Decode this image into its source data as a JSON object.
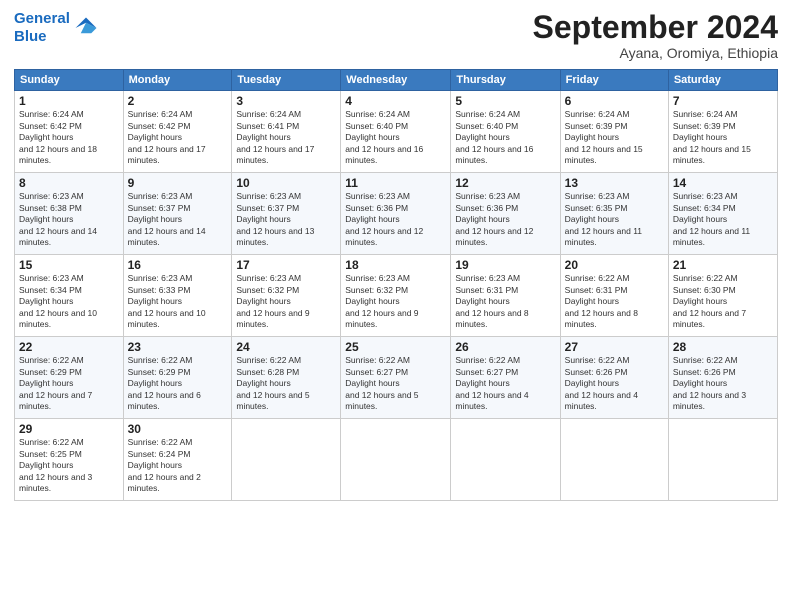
{
  "logo": {
    "line1": "General",
    "line2": "Blue"
  },
  "title": "September 2024",
  "subtitle": "Ayana, Oromiya, Ethiopia",
  "headers": [
    "Sunday",
    "Monday",
    "Tuesday",
    "Wednesday",
    "Thursday",
    "Friday",
    "Saturday"
  ],
  "weeks": [
    [
      {
        "day": "1",
        "sr": "6:24 AM",
        "ss": "6:42 PM",
        "dl": "12 hours and 18 minutes."
      },
      {
        "day": "2",
        "sr": "6:24 AM",
        "ss": "6:42 PM",
        "dl": "12 hours and 17 minutes."
      },
      {
        "day": "3",
        "sr": "6:24 AM",
        "ss": "6:41 PM",
        "dl": "12 hours and 17 minutes."
      },
      {
        "day": "4",
        "sr": "6:24 AM",
        "ss": "6:40 PM",
        "dl": "12 hours and 16 minutes."
      },
      {
        "day": "5",
        "sr": "6:24 AM",
        "ss": "6:40 PM",
        "dl": "12 hours and 16 minutes."
      },
      {
        "day": "6",
        "sr": "6:24 AM",
        "ss": "6:39 PM",
        "dl": "12 hours and 15 minutes."
      },
      {
        "day": "7",
        "sr": "6:24 AM",
        "ss": "6:39 PM",
        "dl": "12 hours and 15 minutes."
      }
    ],
    [
      {
        "day": "8",
        "sr": "6:23 AM",
        "ss": "6:38 PM",
        "dl": "12 hours and 14 minutes."
      },
      {
        "day": "9",
        "sr": "6:23 AM",
        "ss": "6:37 PM",
        "dl": "12 hours and 14 minutes."
      },
      {
        "day": "10",
        "sr": "6:23 AM",
        "ss": "6:37 PM",
        "dl": "12 hours and 13 minutes."
      },
      {
        "day": "11",
        "sr": "6:23 AM",
        "ss": "6:36 PM",
        "dl": "12 hours and 12 minutes."
      },
      {
        "day": "12",
        "sr": "6:23 AM",
        "ss": "6:36 PM",
        "dl": "12 hours and 12 minutes."
      },
      {
        "day": "13",
        "sr": "6:23 AM",
        "ss": "6:35 PM",
        "dl": "12 hours and 11 minutes."
      },
      {
        "day": "14",
        "sr": "6:23 AM",
        "ss": "6:34 PM",
        "dl": "12 hours and 11 minutes."
      }
    ],
    [
      {
        "day": "15",
        "sr": "6:23 AM",
        "ss": "6:34 PM",
        "dl": "12 hours and 10 minutes."
      },
      {
        "day": "16",
        "sr": "6:23 AM",
        "ss": "6:33 PM",
        "dl": "12 hours and 10 minutes."
      },
      {
        "day": "17",
        "sr": "6:23 AM",
        "ss": "6:32 PM",
        "dl": "12 hours and 9 minutes."
      },
      {
        "day": "18",
        "sr": "6:23 AM",
        "ss": "6:32 PM",
        "dl": "12 hours and 9 minutes."
      },
      {
        "day": "19",
        "sr": "6:23 AM",
        "ss": "6:31 PM",
        "dl": "12 hours and 8 minutes."
      },
      {
        "day": "20",
        "sr": "6:22 AM",
        "ss": "6:31 PM",
        "dl": "12 hours and 8 minutes."
      },
      {
        "day": "21",
        "sr": "6:22 AM",
        "ss": "6:30 PM",
        "dl": "12 hours and 7 minutes."
      }
    ],
    [
      {
        "day": "22",
        "sr": "6:22 AM",
        "ss": "6:29 PM",
        "dl": "12 hours and 7 minutes."
      },
      {
        "day": "23",
        "sr": "6:22 AM",
        "ss": "6:29 PM",
        "dl": "12 hours and 6 minutes."
      },
      {
        "day": "24",
        "sr": "6:22 AM",
        "ss": "6:28 PM",
        "dl": "12 hours and 5 minutes."
      },
      {
        "day": "25",
        "sr": "6:22 AM",
        "ss": "6:27 PM",
        "dl": "12 hours and 5 minutes."
      },
      {
        "day": "26",
        "sr": "6:22 AM",
        "ss": "6:27 PM",
        "dl": "12 hours and 4 minutes."
      },
      {
        "day": "27",
        "sr": "6:22 AM",
        "ss": "6:26 PM",
        "dl": "12 hours and 4 minutes."
      },
      {
        "day": "28",
        "sr": "6:22 AM",
        "ss": "6:26 PM",
        "dl": "12 hours and 3 minutes."
      }
    ],
    [
      {
        "day": "29",
        "sr": "6:22 AM",
        "ss": "6:25 PM",
        "dl": "12 hours and 3 minutes."
      },
      {
        "day": "30",
        "sr": "6:22 AM",
        "ss": "6:24 PM",
        "dl": "12 hours and 2 minutes."
      },
      null,
      null,
      null,
      null,
      null
    ]
  ]
}
